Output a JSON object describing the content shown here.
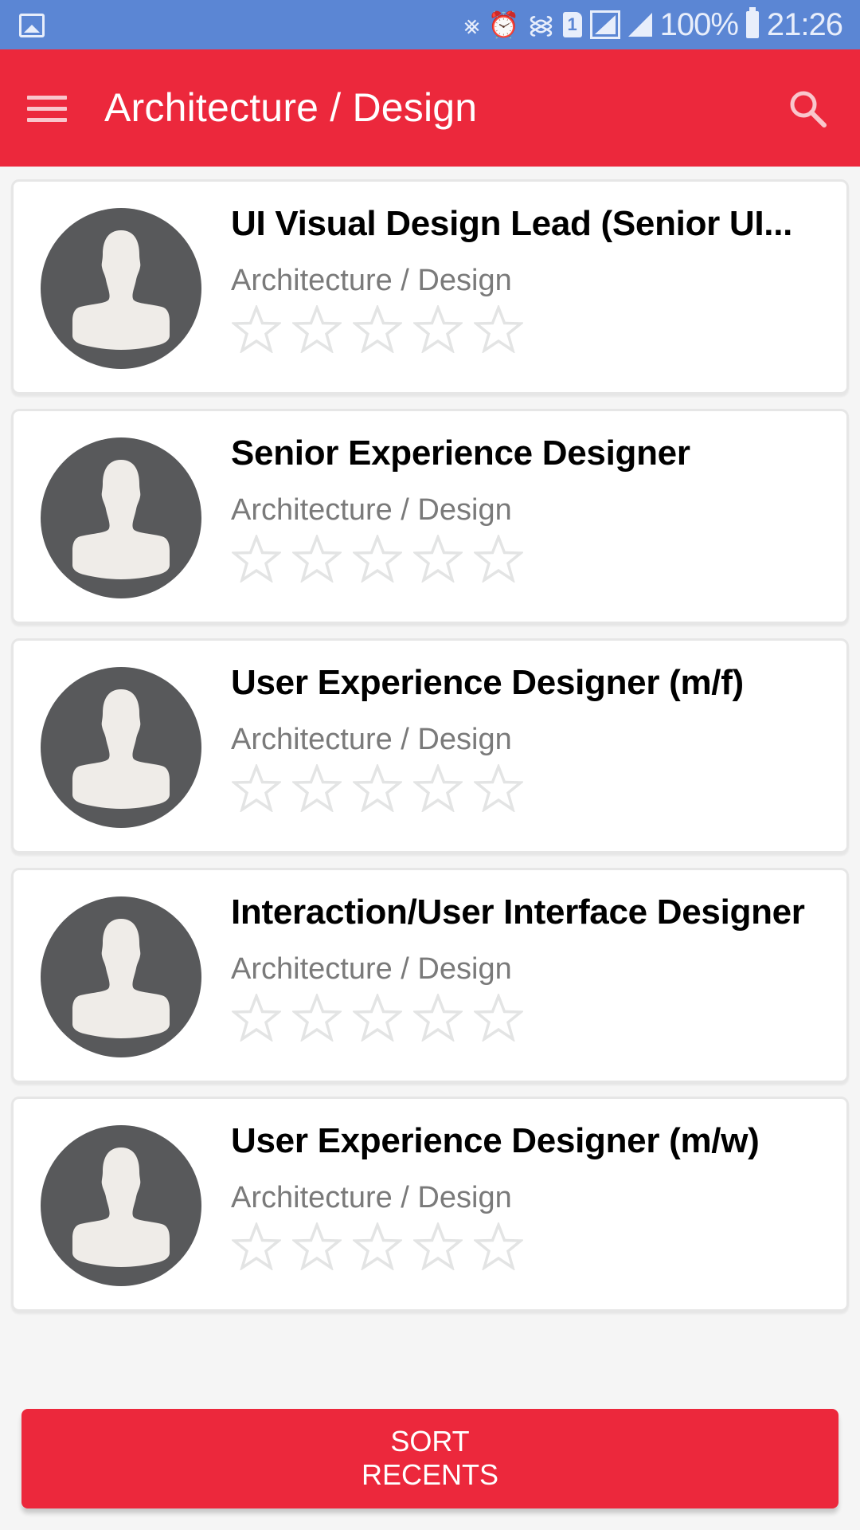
{
  "status_bar": {
    "battery": "100%",
    "time": "21:26",
    "sim_slot": "1",
    "icons": [
      "gallery-icon",
      "vibrate-mute-icon",
      "alarm-icon",
      "wifi-icon",
      "sim-icon",
      "signal-icon",
      "signal-icon",
      "battery-icon"
    ]
  },
  "app_bar": {
    "title": "Architecture / Design",
    "menu_icon": "hamburger-menu-icon",
    "search_icon": "search-icon"
  },
  "colors": {
    "primary": "#ec283c",
    "status_bar": "#5b86d4",
    "background": "#f5f5f5",
    "avatar": "#58595b",
    "star_outline": "#e3e4e4"
  },
  "jobs": [
    {
      "title": "UI Visual Design Lead (Senior UI...",
      "category": "Architecture / Design",
      "rating": 0,
      "max_rating": 5
    },
    {
      "title": "Senior Experience Designer",
      "category": "Architecture / Design",
      "rating": 0,
      "max_rating": 5
    },
    {
      "title": "User Experience Designer (m/f)",
      "category": "Architecture / Design",
      "rating": 0,
      "max_rating": 5
    },
    {
      "title": "Interaction/User Interface Designer",
      "category": "Architecture / Design",
      "rating": 0,
      "max_rating": 5
    },
    {
      "title": "User Experience Designer (m/w)",
      "category": "Architecture / Design",
      "rating": 0,
      "max_rating": 5
    }
  ],
  "sort_button": {
    "line1": "SORT",
    "line2": "RECENTS"
  }
}
